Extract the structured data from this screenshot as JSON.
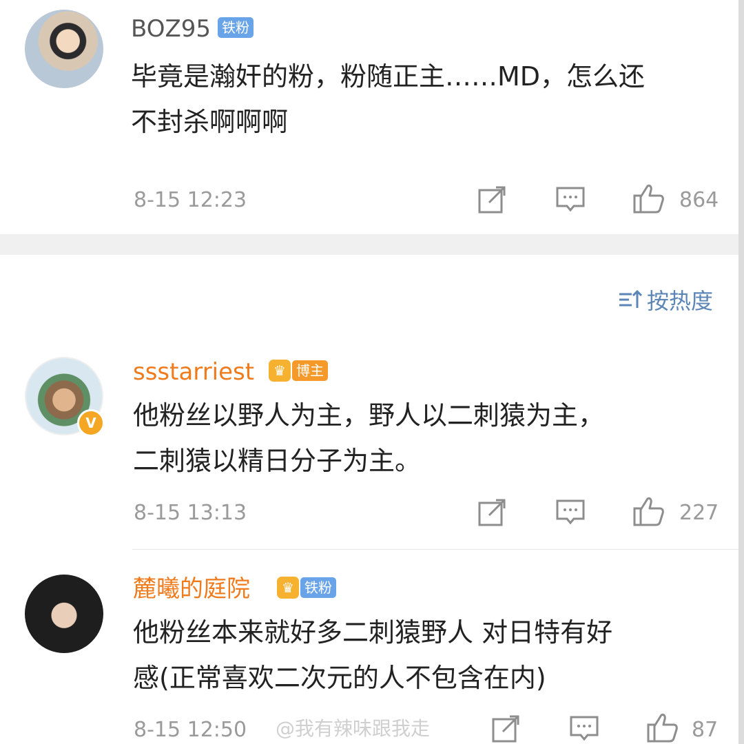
{
  "sort": {
    "icon": "sort-icon",
    "label": "按热度"
  },
  "watermark": "@我有辣味跟我走",
  "comments": [
    {
      "username": "BOZ95",
      "badge": "铁粉",
      "text_line1": "毕竟是瀚奸的粉，粉随正主……MD，怎么还",
      "text_line2": "不封杀啊啊啊",
      "time": "8-15 12:23",
      "likes": "864"
    },
    {
      "username": "ssstarriest",
      "badge": "博主",
      "verified_mark": "V",
      "text_line1": "他粉丝以野人为主，野人以二刺猿为主，",
      "text_line2": "二刺猿以精日分子为主。",
      "time": "8-15 13:13",
      "likes": "227"
    },
    {
      "username": "麓曦的庭院",
      "badge": "铁粉",
      "text_line1": "他粉丝本来就好多二刺猿野人 对日特有好",
      "text_line2": "感(正常喜欢二次元的人不包含在内)",
      "time": "8-15 12:50",
      "likes": "87"
    }
  ],
  "colors": {
    "username_orange": "#f07b1d",
    "badge_blue": "#6aa4e8",
    "badge_orange": "#f59a2a",
    "sort_blue": "#5c86b8",
    "meta_gray": "#9a9a9a"
  }
}
